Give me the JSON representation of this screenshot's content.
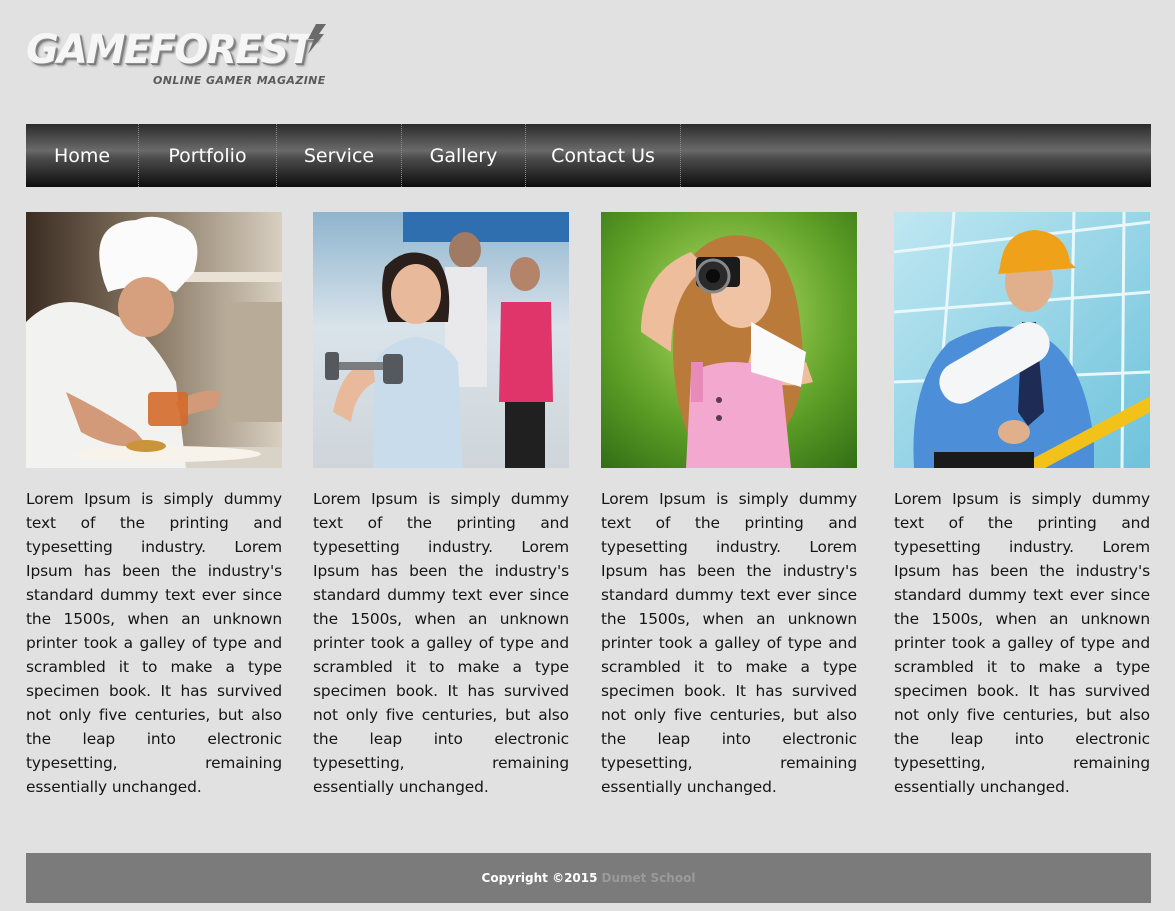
{
  "logo": {
    "title": "GAMEFOREST",
    "subtitle": "ONLINE GAMER MAGAZINE"
  },
  "nav": {
    "items": [
      "Home",
      "Portfolio",
      "Service",
      "Gallery",
      "Contact Us"
    ]
  },
  "columns": [
    {
      "image": "chef-plating-dish-photo",
      "text": "Lorem Ipsum is simply dummy text of the printing and typesetting industry. Lorem Ipsum has been the industry's standard dummy text ever since the 1500s, when an unknown printer took a galley of type and scrambled it to make a type specimen book. It has survived not only five centuries, but also the leap into electronic typesetting, remaining essentially unchanged."
    },
    {
      "image": "woman-with-dumbbell-photo",
      "text": "Lorem Ipsum is simply dummy text of the printing and typesetting industry. Lorem Ipsum has been the industry's standard dummy text ever since the 1500s, when an unknown printer took a galley of type and scrambled it to make a type specimen book. It has survived not only five centuries, but also the leap into electronic typesetting, remaining essentially unchanged."
    },
    {
      "image": "woman-with-camera-photo",
      "text": "Lorem Ipsum is simply dummy text of the printing and typesetting industry. Lorem Ipsum has been the industry's standard dummy text ever since the 1500s, when an unknown printer took a galley of type and scrambled it to make a type specimen book. It has survived not only five centuries, but also the leap into electronic typesetting, remaining essentially unchanged."
    },
    {
      "image": "engineer-with-blueprints-photo",
      "text": "Lorem Ipsum is simply dummy text of the printing and typesetting industry. Lorem Ipsum has been the industry's standard dummy text ever since the 1500s, when an unknown printer took a galley of type and scrambled it to make a type specimen book. It has survived not only five centuries, but also the leap into electronic typesetting, remaining essentially unchanged."
    }
  ],
  "footer": {
    "copyright": "Copyright ©2015",
    "school": "Dumet School"
  },
  "colors": {
    "background": "#e1e1e1",
    "nav_dark": "#0e0e0e",
    "footer": "#7b7b7b",
    "footer_link": "#9a9a9a"
  }
}
